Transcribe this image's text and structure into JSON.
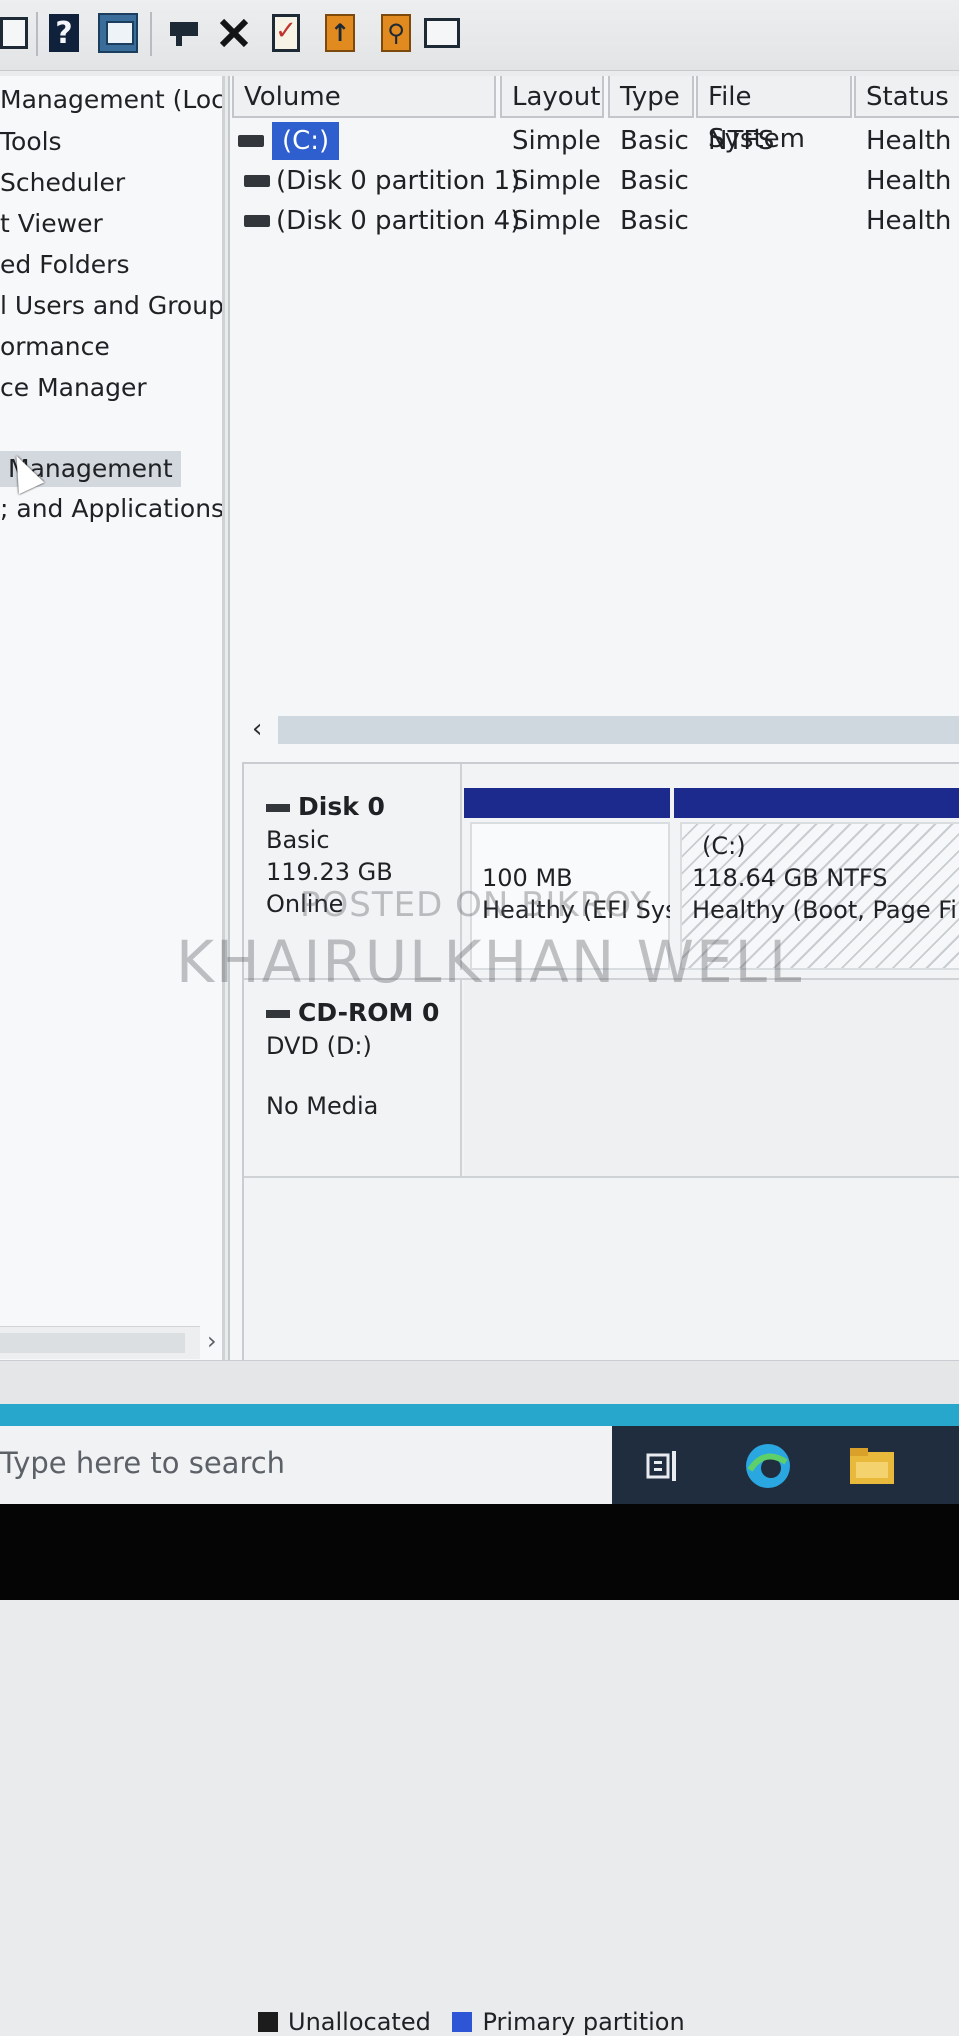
{
  "tree": {
    "items": [
      {
        "label": "Management (Local"
      },
      {
        "label": "Tools"
      },
      {
        "label": "Scheduler"
      },
      {
        "label": "t Viewer"
      },
      {
        "label": "ed Folders"
      },
      {
        "label": "l Users and Groups"
      },
      {
        "label": "ormance"
      },
      {
        "label": "ce Manager"
      },
      {
        "label": "Management",
        "selected": true
      },
      {
        "label": "; and Applications"
      }
    ]
  },
  "volume_list": {
    "columns": [
      "Volume",
      "Layout",
      "Type",
      "File System",
      "Status"
    ],
    "rows": [
      {
        "volume": "(C:)",
        "layout": "Simple",
        "type": "Basic",
        "file_system": "NTFS",
        "status": "Health",
        "selected": true
      },
      {
        "volume": "(Disk 0 partition 1)",
        "layout": "Simple",
        "type": "Basic",
        "file_system": "",
        "status": "Health"
      },
      {
        "volume": "(Disk 0 partition 4)",
        "layout": "Simple",
        "type": "Basic",
        "file_system": "",
        "status": "Health"
      }
    ]
  },
  "disks": [
    {
      "name": "Disk 0",
      "kind": "Basic",
      "size": "119.23 GB",
      "state": "Online",
      "partitions": [
        {
          "label": "",
          "size": "100 MB",
          "status": "Healthy (EFI Sys",
          "color": "#1b2a8c"
        },
        {
          "label": "(C:)",
          "size": "118.64 GB NTFS",
          "status": "Healthy (Boot, Page Fil",
          "color": "#1b2a8c"
        }
      ]
    },
    {
      "name": "CD-ROM 0",
      "kind": "DVD (D:)",
      "state": "No Media"
    }
  ],
  "legend": [
    {
      "label": "Unallocated",
      "color": "#1c1c1c"
    },
    {
      "label": "Primary partition",
      "color": "#2e55d6"
    }
  ],
  "watermark": {
    "line1": "POSTED ON BIKROY",
    "line2": "KHAIRULKHAN WELL"
  },
  "taskbar": {
    "search_placeholder": "Type here to search",
    "icons": [
      "task-view-icon",
      "edge-icon",
      "file-explorer-icon"
    ]
  },
  "toolbar": {
    "icons": [
      "console-tree-icon",
      "help-icon",
      "view-icon",
      "connect-icon",
      "delete-icon",
      "check-icon",
      "export-icon",
      "find-icon",
      "properties-icon"
    ]
  }
}
